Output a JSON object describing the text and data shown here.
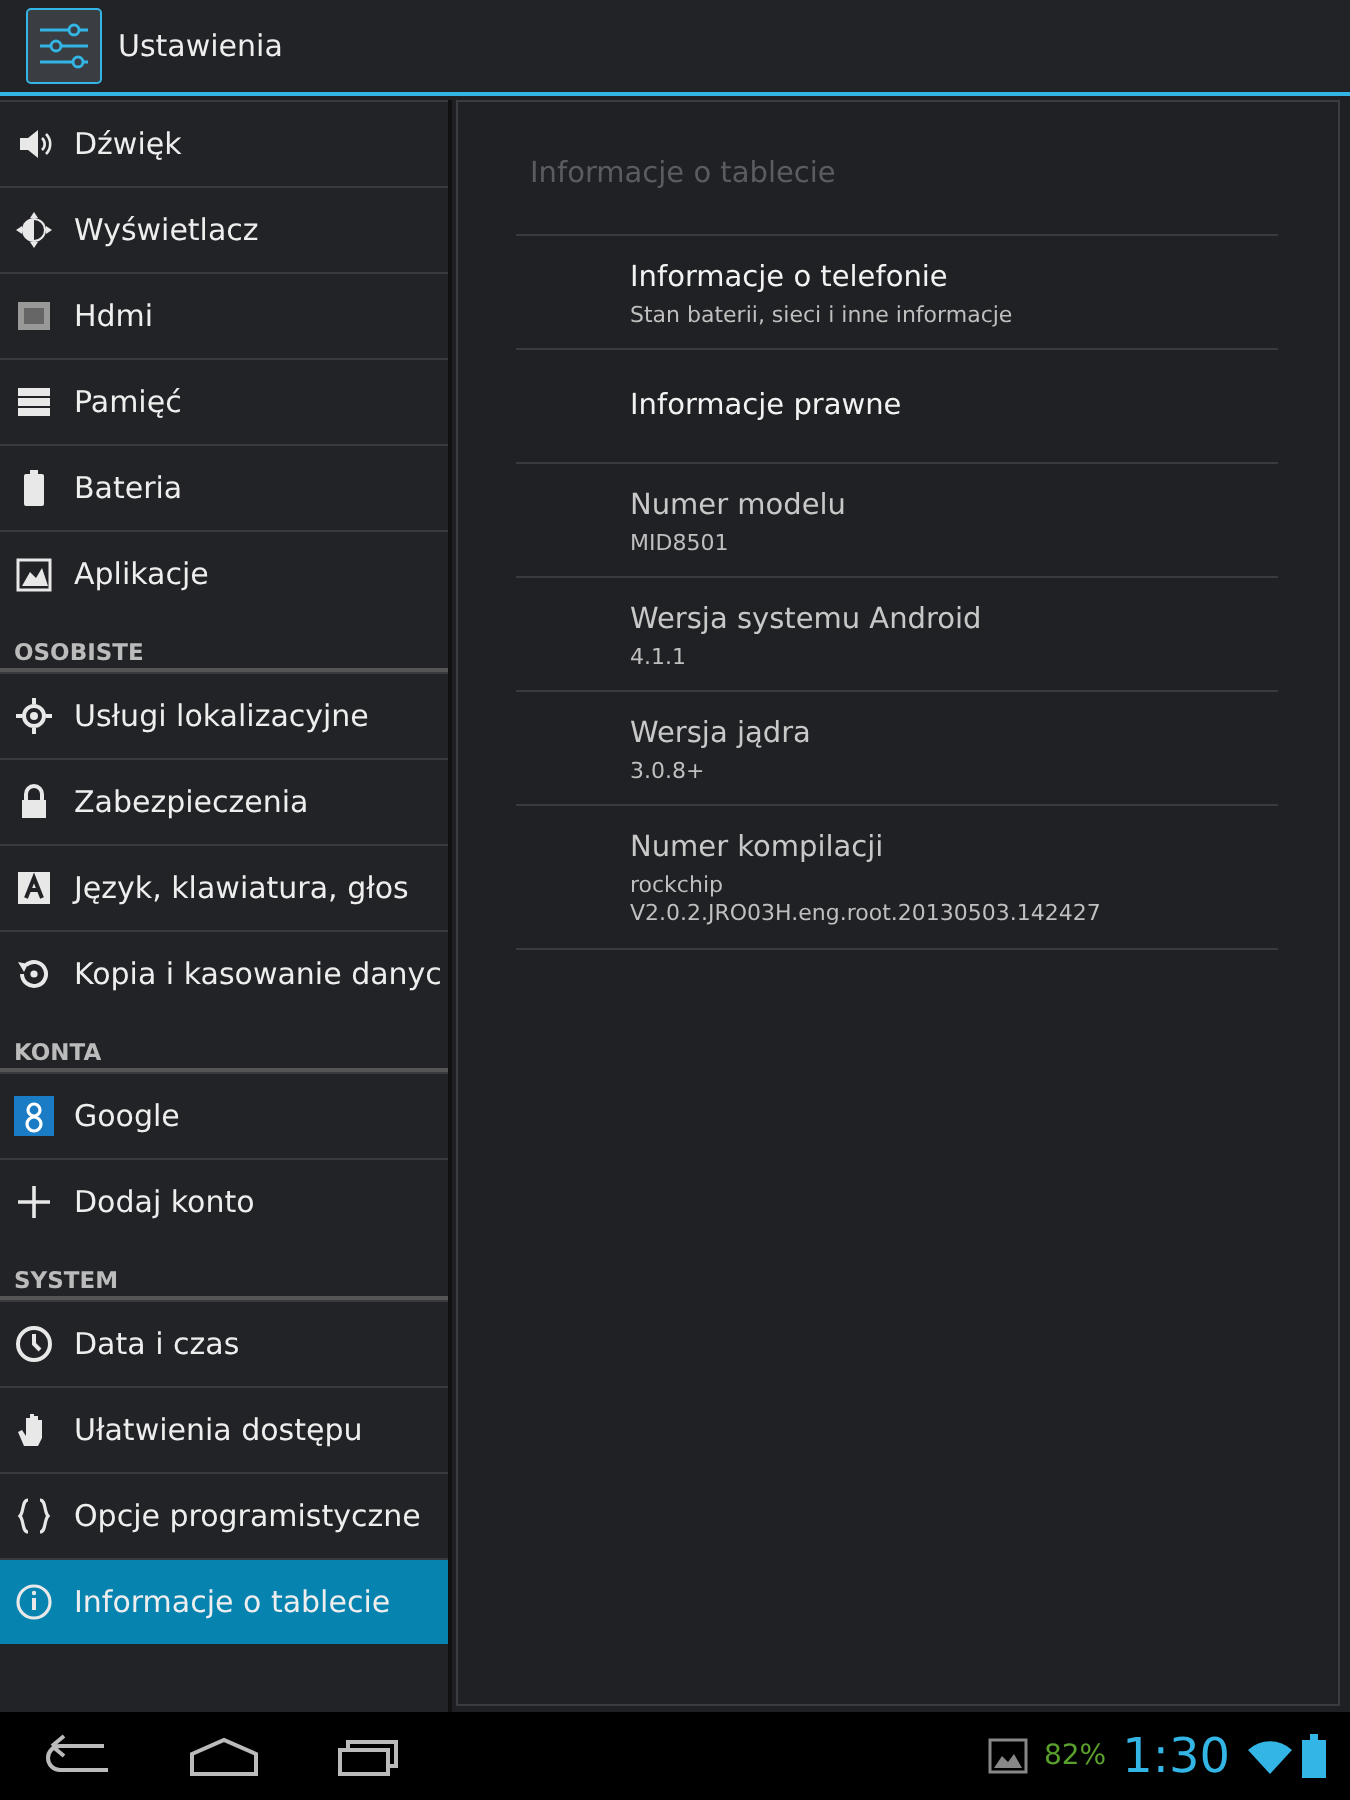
{
  "action_bar": {
    "title": "Ustawienia"
  },
  "sidebar": {
    "items": [
      {
        "kind": "item",
        "label": "Dźwięk",
        "selected": false
      },
      {
        "kind": "item",
        "label": "Wyświetlacz",
        "selected": false
      },
      {
        "kind": "item",
        "label": "Hdmi",
        "selected": false
      },
      {
        "kind": "item",
        "label": "Pamięć",
        "selected": false
      },
      {
        "kind": "item",
        "label": "Bateria",
        "selected": false
      },
      {
        "kind": "item",
        "label": "Aplikacje",
        "selected": false
      },
      {
        "kind": "header",
        "label": "OSOBISTE"
      },
      {
        "kind": "item",
        "label": "Usługi lokalizacyjne",
        "selected": false
      },
      {
        "kind": "item",
        "label": "Zabezpieczenia",
        "selected": false
      },
      {
        "kind": "item",
        "label": "Język, klawiatura, głos",
        "selected": false
      },
      {
        "kind": "item",
        "label": "Kopia i kasowanie danyc",
        "selected": false
      },
      {
        "kind": "header",
        "label": "KONTA"
      },
      {
        "kind": "item",
        "label": "Google",
        "selected": false
      },
      {
        "kind": "item",
        "label": "Dodaj konto",
        "selected": false
      },
      {
        "kind": "header",
        "label": "SYSTEM"
      },
      {
        "kind": "item",
        "label": "Data i czas",
        "selected": false
      },
      {
        "kind": "item",
        "label": "Ułatwienia dostępu",
        "selected": false
      },
      {
        "kind": "item",
        "label": "Opcje programistyczne",
        "selected": false
      },
      {
        "kind": "item",
        "label": "Informacje o tablecie",
        "selected": true
      }
    ]
  },
  "detail": {
    "title": "Informacje o tablecie",
    "rows": [
      {
        "kind": "link",
        "title": "Informacje o telefonie",
        "summary": "Stan baterii, sieci i inne informacje"
      },
      {
        "kind": "link",
        "title": "Informacje prawne"
      },
      {
        "kind": "info",
        "title": "Numer modelu",
        "summary": "MID8501"
      },
      {
        "kind": "info",
        "title": "Wersja systemu Android",
        "summary": "4.1.1"
      },
      {
        "kind": "info",
        "title": "Wersja jądra",
        "summary": "3.0.8+"
      },
      {
        "kind": "info",
        "title": "Numer kompilacji",
        "summary": "rockchip\nV2.0.2.JRO03H.eng.root.20130503.142427"
      }
    ]
  },
  "system_bar": {
    "battery_percent": "82%",
    "time": "1:30"
  }
}
